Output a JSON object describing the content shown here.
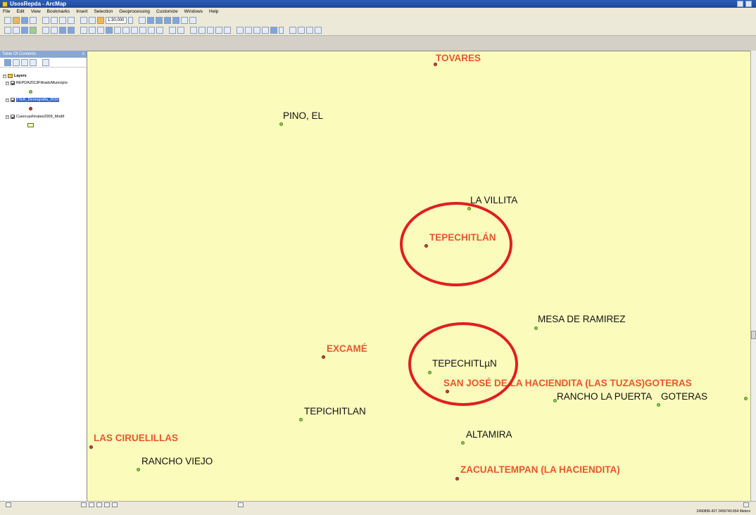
{
  "window": {
    "title": "UsosRepda - ArcMap"
  },
  "menu": [
    "File",
    "Edit",
    "View",
    "Bookmarks",
    "Insert",
    "Selection",
    "Geoprocessing",
    "Customize",
    "Windows",
    "Help"
  ],
  "toolbar": {
    "scale": "1:30,000"
  },
  "toc": {
    "title": "Table Of Contents",
    "close": "x",
    "root": "Layers",
    "layers": [
      {
        "name": "REPDA2013FiltradoMunicipio",
        "symbol_color": "#8fd04a"
      },
      {
        "name": "ITER_Demografia_2010",
        "symbol_color": "#c8473b"
      },
      {
        "name": "CuencasFinales2009_Modif",
        "symbol_color": "#fbfbbc"
      }
    ]
  },
  "map": {
    "labels": {
      "tovares": "TOVARES",
      "pino_el": "PINO, EL",
      "la_villita": "LA VILLITA",
      "tepechitlan": "TEPECHITLÁN",
      "mesa_de_ramirez": "MESA DE RAMIREZ",
      "excame": "EXCAMÉ",
      "tepechitlun": "TEPECHITLµN",
      "san_jose": "SAN JOSÉ DE LA HACIENDITA (LAS TUZAS)GOTERAS",
      "rancho_la_puerta": "RANCHO LA PUERTA",
      "goteras": "GOTERAS",
      "tepichitlan": "TEPICHITLAN",
      "altamira": "ALTAMIRA",
      "las_ciruelillas": "LAS CIRUELILLAS",
      "rancho_viejo": "RANCHO VIEJO",
      "zacualtempan": "ZACUALTEMPAN (LA HACIENDITA)"
    },
    "colors": {
      "background": "#fbfbbc",
      "green_point": "#8fd04a",
      "red_point": "#c8473b",
      "highlight": "#e01f1f",
      "red_label": "#e8562a"
    }
  },
  "status": {
    "coordinates": "2490896.437  2456740.654 Meters"
  }
}
